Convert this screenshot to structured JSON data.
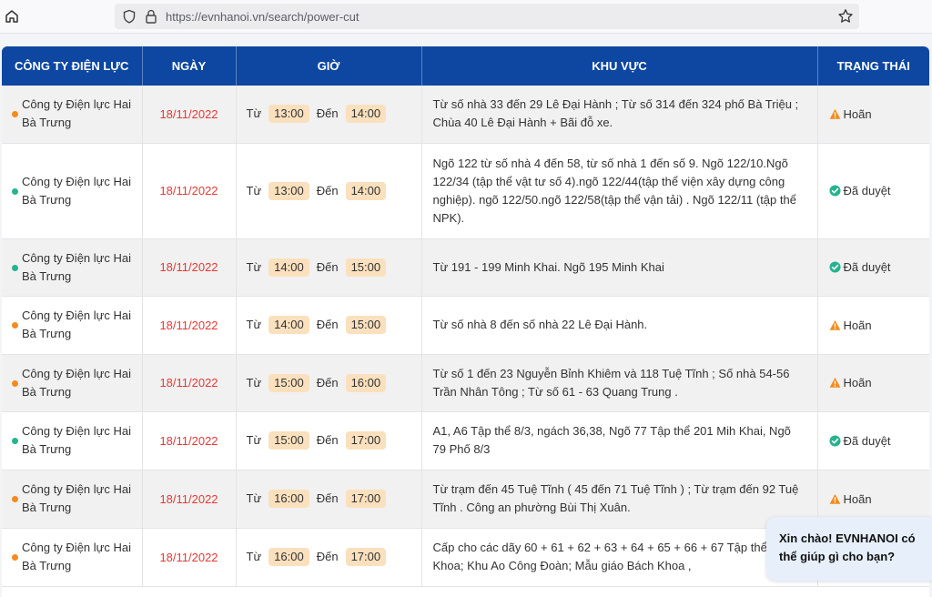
{
  "browser": {
    "url": "https://evnhanoi.vn/search/power-cut"
  },
  "table": {
    "headers": [
      "CÔNG TY ĐIỆN LỰC",
      "NGÀY",
      "GIỜ",
      "KHU VỰC",
      "TRẠNG THÁI"
    ],
    "from_label": "Từ",
    "to_label": "Đến",
    "rows": [
      {
        "company": "Công ty Điện lực Hai Bà Trưng",
        "date": "18/11/2022",
        "from": "13:00",
        "to": "14:00",
        "area": "Từ số nhà 33 đến 29 Lê Đại Hành ; Từ số 314 đến 324 phố Bà Triệu ; Chùa 40 Lê Đại Hành + Bãi đỗ xe.",
        "status": "Hoãn",
        "status_type": "postponed"
      },
      {
        "company": "Công ty Điện lực Hai Bà Trưng",
        "date": "18/11/2022",
        "from": "13:00",
        "to": "14:00",
        "area": "Ngõ 122 từ số nhà 4 đến 58, từ số nhà 1 đến số 9. Ngõ 122/10.Ngõ 122/34 (tập thể vật tư số 4).ngõ 122/44(tập thể viện xây dựng công nghiệp). ngõ 122/50.ngõ 122/58(tập thể vận tải) . Ngõ 122/11 (tập thể NPK).",
        "status": "Đã duyệt",
        "status_type": "approved"
      },
      {
        "company": "Công ty Điện lực Hai Bà Trưng",
        "date": "18/11/2022",
        "from": "14:00",
        "to": "15:00",
        "area": "Từ 191 - 199 Minh Khai. Ngõ 195 Minh Khai",
        "status": "Đã duyệt",
        "status_type": "approved"
      },
      {
        "company": "Công ty Điện lực Hai Bà Trưng",
        "date": "18/11/2022",
        "from": "14:00",
        "to": "15:00",
        "area": "Từ số nhà 8 đến số nhà 22 Lê Đại Hành.",
        "status": "Hoãn",
        "status_type": "postponed"
      },
      {
        "company": "Công ty Điện lực Hai Bà Trưng",
        "date": "18/11/2022",
        "from": "15:00",
        "to": "16:00",
        "area": "Từ số 1 đến 23 Nguyễn Bỉnh Khiêm và 118 Tuệ Tĩnh ; Số nhà 54-56 Trần Nhân Tông ; Từ số 61 - 63 Quang Trung .",
        "status": "Hoãn",
        "status_type": "postponed"
      },
      {
        "company": "Công ty Điện lực Hai Bà Trưng",
        "date": "18/11/2022",
        "from": "15:00",
        "to": "17:00",
        "area": "A1, A6 Tập thể 8/3, ngách 36,38, Ngõ 77 Tập thể 201 Mih Khai, Ngõ 79 Phố 8/3",
        "status": "Đã duyệt",
        "status_type": "approved"
      },
      {
        "company": "Công ty Điện lực Hai Bà Trưng",
        "date": "18/11/2022",
        "from": "16:00",
        "to": "17:00",
        "area": "Từ trạm đến 45 Tuệ Tĩnh ( 45 đến 71 Tuệ Tĩnh ) ; Từ trạm đến 92 Tuệ Tĩnh . Công an phường Bùi Thị Xuân.",
        "status": "Hoãn",
        "status_type": "postponed"
      },
      {
        "company": "Công ty Điện lực Hai Bà Trưng",
        "date": "18/11/2022",
        "from": "16:00",
        "to": "17:00",
        "area": "Cấp cho các dãy 60 + 61 + 62 + 63 + 64 + 65 + 66 + 67 Tập thể Bách Khoa; Khu Ao Công Đoàn; Mẫu giáo Bách Khoa ,",
        "status": "",
        "status_type": "none"
      }
    ]
  },
  "chat": {
    "message": "Xin chào! EVNHANOI có thể giúp gì cho bạn?"
  },
  "colors": {
    "header_bg": "#0d47a1",
    "date_red": "#e53935",
    "time_pill": "#fbe0bd",
    "dot_orange": "#f28c1e",
    "dot_green": "#26b38f",
    "status_postponed": "#f28c1e",
    "status_approved": "#26b38f",
    "chat_bg": "#e6effa"
  }
}
